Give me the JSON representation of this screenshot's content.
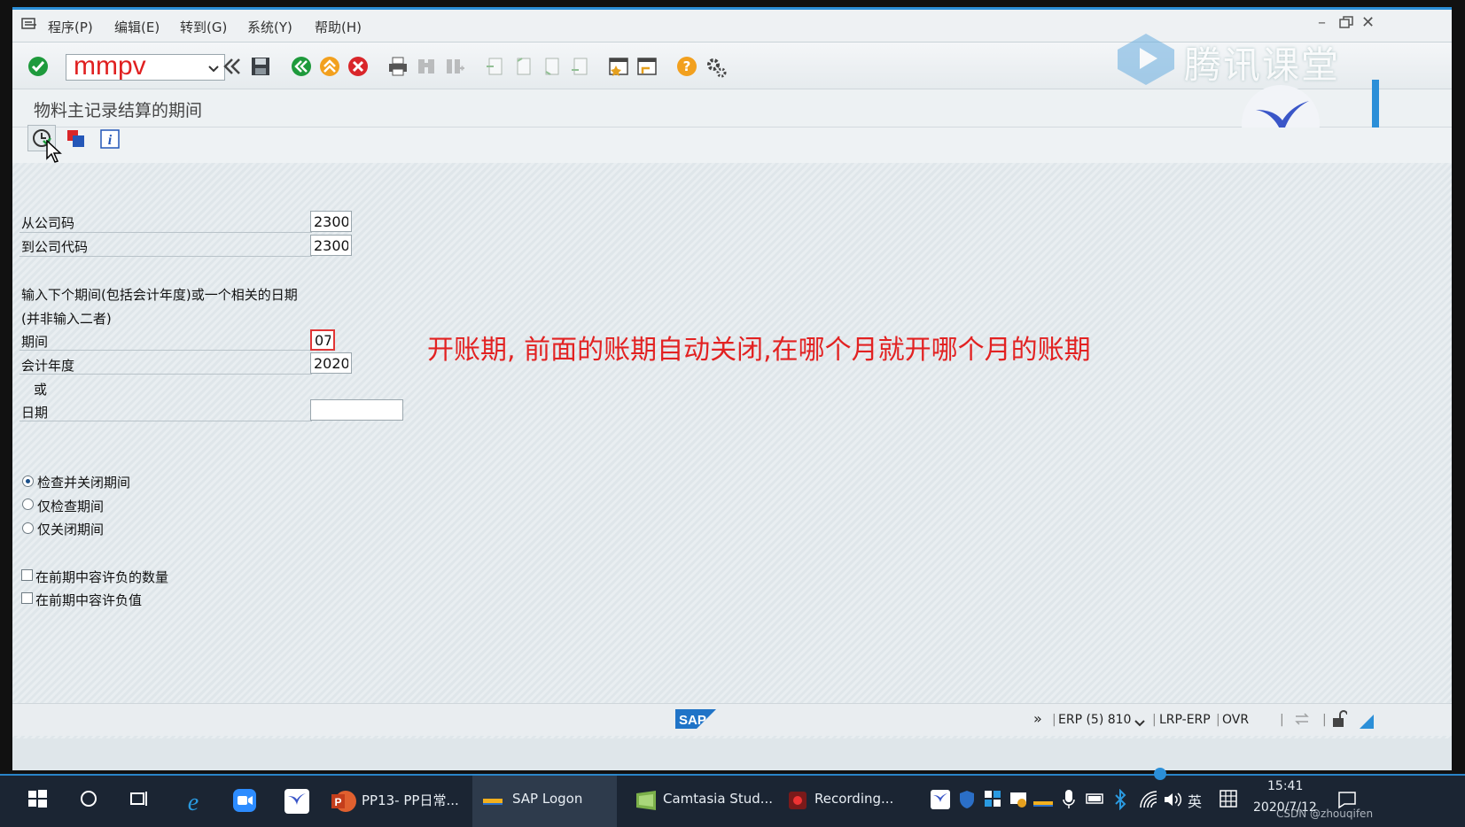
{
  "menu": {
    "items": [
      "程序(P)",
      "编辑(E)",
      "转到(G)",
      "系统(Y)",
      "帮助(H)"
    ]
  },
  "toolbar": {
    "command_value": "mmpv"
  },
  "watermark": {
    "brand": "腾讯课堂"
  },
  "title": "物料主记录结算的期间",
  "form": {
    "from_company_label": "从公司码",
    "from_company_value": "2300",
    "to_company_label": "到公司代码",
    "to_company_value": "2300",
    "instruction_line1": "输入下个期间(包括会计年度)或一个相关的日期",
    "instruction_line2": "(并非输入二者)",
    "period_label": "期间",
    "period_value": "07",
    "fiscal_year_label": "会计年度",
    "fiscal_year_value": "2020",
    "or_label": "或",
    "date_label": "日期",
    "date_value": ""
  },
  "options": {
    "radios": [
      {
        "label": "检查并关闭期间",
        "selected": true
      },
      {
        "label": "仅检查期间",
        "selected": false
      },
      {
        "label": "仅关闭期间",
        "selected": false
      }
    ],
    "checkboxes": [
      {
        "label": "在前期中容许负的数量",
        "checked": false
      },
      {
        "label": "在前期中容许负值",
        "checked": false
      }
    ]
  },
  "annotation": "开账期, 前面的账期自动关闭,在哪个月就开哪个月的账期",
  "statusbar": {
    "sap_logo": "SAP",
    "system": "ERP (5) 810",
    "server": "LRP-ERP",
    "mode": "OVR",
    "expand": "»"
  },
  "taskbar": {
    "apps": [
      "PP13- PP日常...",
      "SAP Logon",
      "Camtasia Stud...",
      "Recording..."
    ],
    "ime": "英",
    "time": "15:41",
    "date": "2020/7/12",
    "watermark": "CSDN @zhouqifen"
  }
}
